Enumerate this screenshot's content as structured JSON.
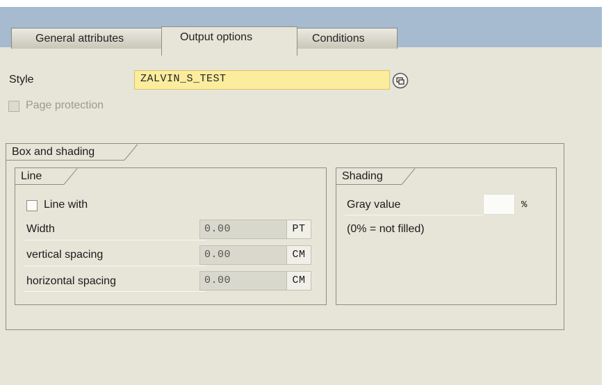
{
  "tabs": [
    {
      "label": "General attributes",
      "active": false
    },
    {
      "label": "Output options",
      "active": true
    },
    {
      "label": "Conditions",
      "active": false
    }
  ],
  "style_field": {
    "label": "Style",
    "value": "ZALVIN_S_TEST",
    "button_icon": "possible-entries-icon"
  },
  "page_protection": {
    "label": "Page protection",
    "checked": false,
    "enabled": false
  },
  "box_and_shading": {
    "title": "Box and shading",
    "line": {
      "title": "Line",
      "line_with": {
        "label": "Line with",
        "checked": false
      },
      "rows": [
        {
          "label": "Width",
          "value": "0.00",
          "unit": "PT"
        },
        {
          "label": "vertical spacing",
          "value": "0.00",
          "unit": "CM"
        },
        {
          "label": "horizontal spacing",
          "value": "0.00",
          "unit": "CM"
        }
      ]
    },
    "shading": {
      "title": "Shading",
      "gray_value_label": "Gray value",
      "gray_value": "",
      "percent_sign": "%",
      "hint": "(0% = not filled)"
    }
  },
  "colors": {
    "window_bg": "#e7e5d8",
    "header_bg": "#a6bbd0",
    "required_field_bg": "#fbec9e",
    "readonly_field_bg": "#d9d8cc"
  }
}
